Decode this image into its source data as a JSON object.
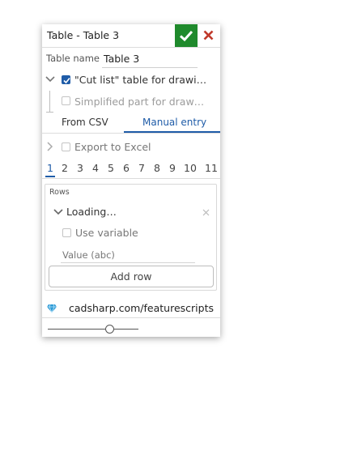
{
  "dialog": {
    "title": "Table - Table 3",
    "ok_icon": "check-icon",
    "close_icon": "close-icon",
    "accent_ok": "#1f8a2c",
    "accent_close": "#c0392b",
    "accent_blue": "#1f5ca8"
  },
  "table_name": {
    "label": "Table name",
    "value": "Table 3"
  },
  "options": {
    "cut_list_label": "\"Cut list\" table for drawi…",
    "cut_list_checked": true,
    "simplified_label": "Simplified part for draw…",
    "simplified_checked": false
  },
  "tabs": {
    "from_csv": "From CSV",
    "manual_entry": "Manual entry",
    "active": "manual_entry"
  },
  "export": {
    "label": "Export to Excel",
    "checked": false
  },
  "pages": {
    "items": [
      "1",
      "2",
      "3",
      "4",
      "5",
      "6",
      "7",
      "8",
      "9",
      "10",
      "11"
    ],
    "active": "1"
  },
  "rows": {
    "title": "Rows",
    "item_label": "Loading…",
    "use_variable_label": "Use variable",
    "value_placeholder": "Value (abc)",
    "add_row_label": "Add row"
  },
  "footer": {
    "link_text": "cadsharp.com/featurescripts",
    "link_icon": "diamond-icon",
    "slider_value": 0.7
  }
}
